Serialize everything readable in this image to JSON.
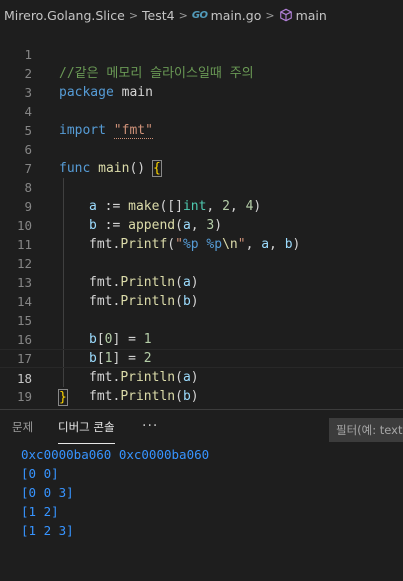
{
  "breadcrumb": {
    "items": [
      "Mirero.Golang.Slice",
      "Test4",
      "main.go",
      "main"
    ],
    "go_icon": "GO",
    "separator": ">"
  },
  "editor": {
    "current_line": 18,
    "lines": [
      {
        "n": "1"
      },
      {
        "n": "2"
      },
      {
        "n": "3"
      },
      {
        "n": "4"
      },
      {
        "n": "5"
      },
      {
        "n": "6"
      },
      {
        "n": "7"
      },
      {
        "n": "8"
      },
      {
        "n": "9"
      },
      {
        "n": "10"
      },
      {
        "n": "11"
      },
      {
        "n": "12"
      },
      {
        "n": "13"
      },
      {
        "n": "14"
      },
      {
        "n": "15"
      },
      {
        "n": "16"
      },
      {
        "n": "17"
      },
      {
        "n": "18"
      },
      {
        "n": "19"
      }
    ],
    "tokens": {
      "l1_comment": "//같은 메모리 슬라이스일때 주의",
      "l2_kw": "package",
      "l2_name": " main",
      "l4_kw": "import",
      "l4_str": "\"fmt\"",
      "l6_kw": "func",
      "l6_fn": "main",
      "l6_paren": "() ",
      "l6_brace": "{",
      "l7_var": "a",
      "l7_op": " := ",
      "l7_fn": "make",
      "l7_open": "([]",
      "l7_type": "int",
      "l7_sep1": ", ",
      "l7_num1": "2",
      "l7_sep2": ", ",
      "l7_num2": "4",
      "l7_close": ")",
      "l8_var": "b",
      "l8_op": " := ",
      "l8_fn": "append",
      "l8_open": "(",
      "l8_arg": "a",
      "l8_sep": ", ",
      "l8_num": "3",
      "l8_close": ")",
      "l9_pkg": "fmt",
      "l9_dot": ".",
      "l9_fn": "Printf",
      "l9_open": "(",
      "l9_q1": "\"",
      "l9_f1": "%p",
      "l9_sp": " ",
      "l9_f2": "%p",
      "l9_esc": "\\n",
      "l9_q2": "\"",
      "l9_rest1": ", ",
      "l9_a": "a",
      "l9_rest2": ", ",
      "l9_b": "b",
      "l9_close": ")",
      "l11_pkg": "fmt",
      "l11_dot": ".",
      "l11_fn": "Println",
      "l11_open": "(",
      "l11_arg": "a",
      "l11_close": ")",
      "l12_pkg": "fmt",
      "l12_dot": ".",
      "l12_fn": "Println",
      "l12_open": "(",
      "l12_arg": "b",
      "l12_close": ")",
      "l14_var": "b",
      "l14_idx": "[",
      "l14_num": "0",
      "l14_idx2": "]",
      "l14_op": " = ",
      "l14_val": "1",
      "l15_var": "b",
      "l15_idx": "[",
      "l15_num": "1",
      "l15_idx2": "]",
      "l15_op": " = ",
      "l15_val": "2",
      "l16_pkg": "fmt",
      "l16_dot": ".",
      "l16_fn": "Println",
      "l16_open": "(",
      "l16_arg": "a",
      "l16_close": ")",
      "l17_pkg": "fmt",
      "l17_dot": ".",
      "l17_fn": "Println",
      "l17_open": "(",
      "l17_arg": "b",
      "l17_close": ")",
      "l18_brace": "}"
    }
  },
  "panel": {
    "tabs": [
      "문제",
      "디버그 콘솔"
    ],
    "active_tab": "디버그 콘솔",
    "more": "···",
    "filter_placeholder": "필터(예: text,",
    "console_output": [
      "0xc0000ba060 0xc0000ba060",
      "[0 0]",
      "[0 0 3]",
      "[1 2]",
      "[1 2 3]"
    ]
  },
  "colors": {
    "background": "#1e1e1e",
    "comment": "#6a9955",
    "keyword": "#569cd6",
    "function": "#dcdcaa",
    "string": "#ce9178",
    "number": "#b5cea8",
    "variable": "#9cdcfe",
    "type": "#4ec9b0",
    "brace": "#ffd700",
    "console_text": "#3794ff"
  }
}
